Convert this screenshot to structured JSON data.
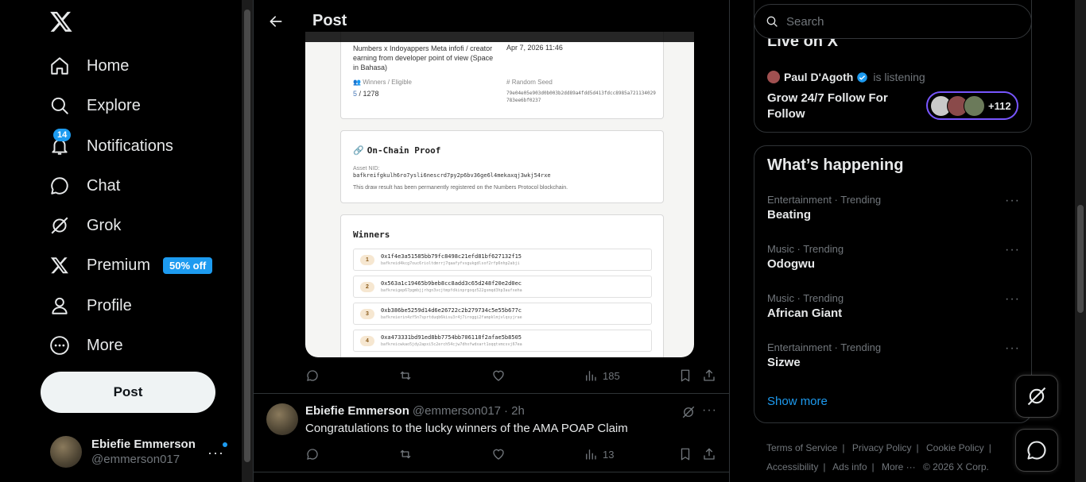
{
  "nav": {
    "items": [
      {
        "label": "Home",
        "icon": "home-icon"
      },
      {
        "label": "Explore",
        "icon": "search-icon"
      },
      {
        "label": "Notifications",
        "icon": "bell-icon",
        "badge": "14"
      },
      {
        "label": "Chat",
        "icon": "chat-icon"
      },
      {
        "label": "Grok",
        "icon": "grok-icon"
      },
      {
        "label": "Premium",
        "icon": "x-icon",
        "promo": "50% off"
      },
      {
        "label": "Profile",
        "icon": "person-icon"
      },
      {
        "label": "More",
        "icon": "more-circle-icon"
      }
    ],
    "post_button": "Post",
    "account": {
      "name": "Ebiefie Emmerson",
      "handle": "@emmerson017"
    }
  },
  "header": {
    "title": "Post"
  },
  "draw_card": {
    "topic": "Numbers x Indoyappers Meta infofi / creator earning from developer point of view (Space in Bahasa)",
    "date": "Apr 7, 2026 11:46",
    "winners_label": "Winners / Eligible",
    "winners_value": "5",
    "eligible_value": "/ 1278",
    "seed_label": "Random Seed",
    "seed_value": "79e04e05e903d0b003b2dd89a4fdd5d413fdcc8985a721134029783ee6bf0237",
    "proof_title": "On-Chain Proof",
    "asset_label": "Asset NID:",
    "asset_value": "bafkreifgkulh6ro7ysli6nescrd7py2p6bv36ge6l4mekaxqj3wkj54rxe",
    "proof_note": "This draw result has been permanently registered on the Numbers Protocol blockchain.",
    "winners_title": "Winners",
    "winners": [
      {
        "rank": "1",
        "address": "0x1f4e3a51585bb79fc8498c21efd81bf627132f15",
        "nid": "bafkreid4kcg7ouc6rioltdmrrj7qaafyfvsgukgdlsof2rfp6nhp2abji"
      },
      {
        "rank": "2",
        "address": "0x563a1c19465b9beb8cc8add3c65d248f20e2d0ec",
        "nid": "bafkreigep67pgmbjjrhgn3vcjtmpfdkinprgoqz522gsmqd3hp3aufxeha"
      },
      {
        "rank": "3",
        "address": "0xb386be5259d14d6e26722c2b279734c5e55b677c",
        "nid": "bafkreierin4zf5n7sprtduqb6kisu3r4j7iroggi2fampklmjvlqsyjrae"
      },
      {
        "rank": "4",
        "address": "0xa473331bd91ed8bb7754bb706118f2afae5b8505",
        "nid": "bafkreicwkao5jdy2apxi5c2erch54cjw7dhxfwdxart1oqqtvmcsvj67ea"
      }
    ]
  },
  "post_actions": {
    "views": "185"
  },
  "reply": {
    "name": "Ebiefie Emmerson",
    "handle": "@emmerson017",
    "time": "· 2h",
    "text": "Congratulations to the lucky winners of the AMA POAP Claim",
    "views": "13"
  },
  "search": {
    "placeholder": "Search"
  },
  "live": {
    "title": "Live on X",
    "user": "Paul D'Agoth",
    "status": "is listening",
    "space_title": "Grow 24/7 Follow For Follow",
    "listener_count": "+112"
  },
  "happening": {
    "title": "What’s happening",
    "trends": [
      {
        "category": "Entertainment · Trending",
        "name": "Beating"
      },
      {
        "category": "Music · Trending",
        "name": "Odogwu"
      },
      {
        "category": "Music · Trending",
        "name": "African Giant"
      },
      {
        "category": "Entertainment · Trending",
        "name": "Sizwe"
      }
    ],
    "show_more": "Show more"
  },
  "footer": {
    "links": [
      "Terms of Service",
      "|",
      "Privacy Policy",
      "|",
      "Cookie Policy",
      "|",
      "Accessibility",
      "|",
      "Ads info",
      "|",
      "More ···",
      "© 2026 X Corp."
    ]
  },
  "colors": {
    "accent": "#1d9bf0",
    "background": "#000000",
    "border": "#2f3336",
    "muted": "#71767b",
    "live_ring": "#7856ff"
  }
}
